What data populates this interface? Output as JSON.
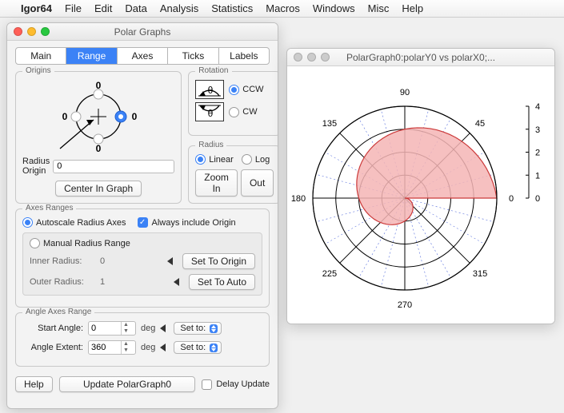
{
  "menubar": {
    "app": "Igor64",
    "items": [
      "File",
      "Edit",
      "Data",
      "Analysis",
      "Statistics",
      "Macros",
      "Windows",
      "Misc",
      "Help"
    ]
  },
  "panel": {
    "title": "Polar Graphs",
    "tabs": [
      "Main",
      "Range",
      "Axes",
      "Ticks",
      "Labels"
    ],
    "active_tab": "Range",
    "origins": {
      "label": "Origins",
      "zeros": [
        "0",
        "0",
        "0",
        "0"
      ],
      "radius_origin_label": "Radius Origin",
      "radius_origin_value": "0",
      "center_btn": "Center In Graph"
    },
    "rotation": {
      "label": "Rotation",
      "ccw": "CCW",
      "cw": "CW",
      "theta": "θ"
    },
    "radius": {
      "label": "Radius",
      "linear": "Linear",
      "log": "Log",
      "zoom_in": "Zoom In",
      "zoom_out": "Out"
    },
    "axes_ranges": {
      "label": "Axes Ranges",
      "autoscale": "Autoscale Radius Axes",
      "always_origin": "Always include Origin",
      "manual": "Manual Radius Range",
      "inner_label": "Inner Radius:",
      "inner_value": "0",
      "outer_label": "Outer Radius:",
      "outer_value": "1",
      "set_to_origin": "Set To Origin",
      "set_to_auto": "Set To Auto"
    },
    "angle_range": {
      "label": "Angle Axes Range",
      "start_label": "Start Angle:",
      "start_value": "0",
      "extent_label": "Angle Extent:",
      "extent_value": "360",
      "unit": "deg",
      "set_to": "Set to:"
    },
    "help_btn": "Help",
    "update_btn": "Update PolarGraph0",
    "delay_label": "Delay Update"
  },
  "graph_window": {
    "title": "PolarGraph0:polarY0 vs polarX0;...",
    "angles": {
      "n": "90",
      "ne": "45",
      "e": "0",
      "se": "315",
      "s": "270",
      "sw": "225",
      "w": "180",
      "nw": "135"
    },
    "scale": [
      "0",
      "1",
      "2",
      "3",
      "4"
    ]
  },
  "chart_data": {
    "type": "polar-area",
    "title": "",
    "angle_unit": "deg",
    "angle_ticks": [
      0,
      45,
      90,
      135,
      180,
      225,
      270,
      315
    ],
    "radius_range": [
      0,
      4
    ],
    "radius_ticks": [
      0,
      1,
      2,
      3,
      4
    ],
    "series": [
      {
        "name": "polarY0",
        "theta_deg": [
          0,
          30,
          60,
          90,
          120,
          150,
          180,
          210,
          240,
          270,
          300,
          330,
          360
        ],
        "r": [
          4.0,
          3.67,
          3.33,
          3.0,
          2.67,
          2.33,
          2.0,
          1.67,
          1.33,
          1.0,
          0.67,
          0.33,
          0.0
        ],
        "fill": "#f4b5b5",
        "stroke": "#cc3a3a"
      }
    ],
    "minor_angle_lines": [
      15,
      30,
      60,
      75,
      105,
      120,
      150,
      165,
      195,
      210,
      240,
      255,
      285,
      300,
      330,
      345
    ]
  }
}
